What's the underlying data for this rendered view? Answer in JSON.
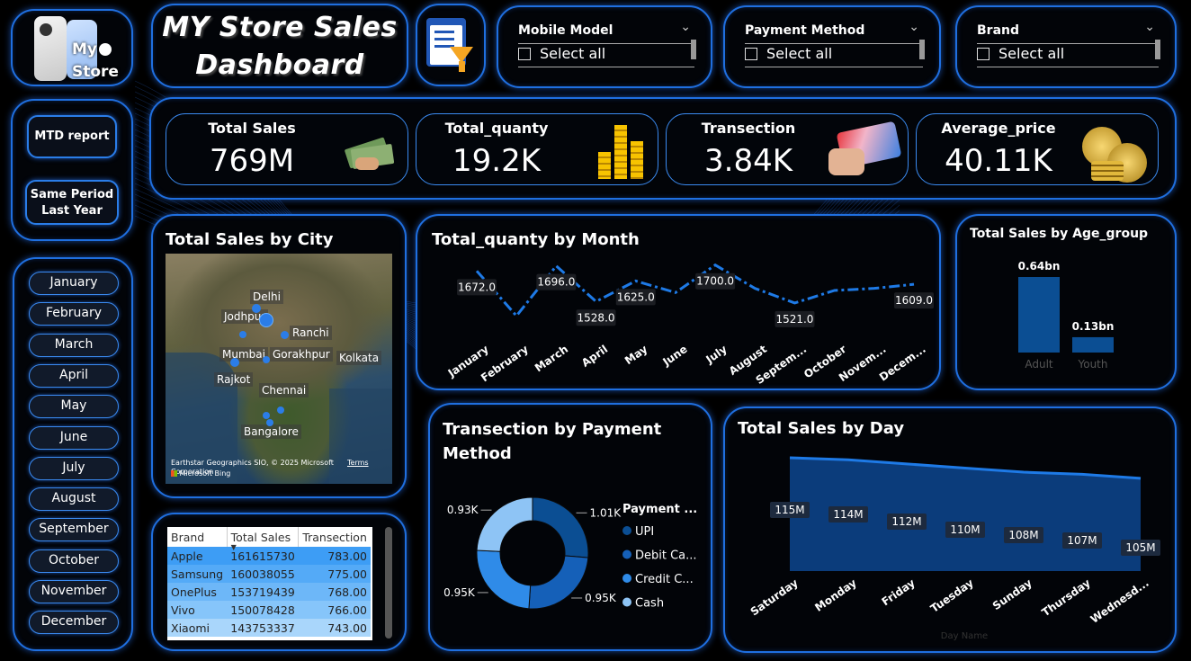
{
  "logo": {
    "line1": "My",
    "line2": "Store"
  },
  "title": {
    "line1": "MY Store Sales",
    "line2": "Dashboard"
  },
  "slicers": [
    {
      "title": "Mobile Model",
      "option": "Select all"
    },
    {
      "title": "Payment Method",
      "option": "Select all"
    },
    {
      "title": "Brand",
      "option": "Select all"
    }
  ],
  "buttons": {
    "mtd": "MTD report",
    "same_period_1": "Same Period",
    "same_period_2": "Last Year"
  },
  "months": [
    "January",
    "February",
    "March",
    "April",
    "May",
    "June",
    "July",
    "August",
    "September",
    "October",
    "November",
    "December"
  ],
  "kpis": [
    {
      "label": "Total Sales",
      "value": "769M"
    },
    {
      "label": "Total_quanty",
      "value": "19.2K"
    },
    {
      "label": "Transection",
      "value": "3.84K"
    },
    {
      "label": "Average_price",
      "value": "40.11K"
    }
  ],
  "map": {
    "title": "Total Sales by City",
    "cities": [
      "Delhi",
      "Jodhpur",
      "Ranchi",
      "Mumbai",
      "Gorakhpur",
      "Kolkata",
      "Rajkot",
      "Chennai",
      "Bangalore"
    ],
    "attribution": "Earthstar Geographics SIO, © 2025 Microsoft Corporation",
    "terms": "Terms",
    "bing": "Microsoft Bing"
  },
  "table": {
    "headers": [
      "Brand",
      "Total Sales",
      "Transection"
    ],
    "rows": [
      [
        "Apple",
        "161615730",
        "783.00"
      ],
      [
        "Samsung",
        "160038055",
        "775.00"
      ],
      [
        "OnePlus",
        "153719439",
        "768.00"
      ],
      [
        "Vivo",
        "150078428",
        "766.00"
      ],
      [
        "Xiaomi",
        "143753337",
        "743.00"
      ]
    ]
  },
  "colors": {
    "accent": "#1f6fe0",
    "bar": "#0b4e93",
    "line": "#1e7ae6"
  },
  "chart_data": [
    {
      "type": "line",
      "title": "Total_quanty by Month",
      "categories": [
        "January",
        "February",
        "March",
        "April",
        "May",
        "June",
        "July",
        "August",
        "Septem...",
        "October",
        "Novem...",
        "Decem..."
      ],
      "values": [
        1672.0,
        1460,
        1696.0,
        1528.0,
        1625.0,
        1570,
        1700.0,
        1590,
        1521.0,
        1580,
        1590,
        1609.0
      ],
      "data_labels": [
        {
          "index": 0,
          "text": "1672.0"
        },
        {
          "index": 2,
          "text": "1696.0"
        },
        {
          "index": 3,
          "text": "1528.0"
        },
        {
          "index": 4,
          "text": "1625.0"
        },
        {
          "index": 6,
          "text": "1700.0"
        },
        {
          "index": 8,
          "text": "1521.0"
        },
        {
          "index": 11,
          "text": "1609.0"
        }
      ]
    },
    {
      "type": "bar",
      "title": "Total Sales by Age_group",
      "categories": [
        "Adult",
        "Youth"
      ],
      "values": [
        0.64,
        0.13
      ],
      "value_labels": [
        "0.64bn",
        "0.13bn"
      ]
    },
    {
      "type": "pie",
      "title": "Transection by Payment Method",
      "legend_title": "Payment ...",
      "series": [
        {
          "name": "UPI",
          "value": 1.01,
          "label": "1.01K",
          "color": "#0b4e93"
        },
        {
          "name": "Debit Ca...",
          "value": 0.95,
          "label": "0.95K",
          "color": "#1560b8"
        },
        {
          "name": "Credit C...",
          "value": 0.95,
          "label": "0.95K",
          "color": "#2f8be8"
        },
        {
          "name": "Cash",
          "value": 0.93,
          "label": "0.93K",
          "color": "#8ec4f5"
        }
      ]
    },
    {
      "type": "area",
      "title": "Total Sales by Day",
      "xlabel": "Day Name",
      "categories": [
        "Saturday",
        "Monday",
        "Friday",
        "Tuesday",
        "Sunday",
        "Thursday",
        "Wednesd..."
      ],
      "values": [
        115,
        114,
        112,
        110,
        108,
        107,
        105
      ],
      "value_labels": [
        "115M",
        "114M",
        "112M",
        "110M",
        "108M",
        "107M",
        "105M"
      ]
    }
  ]
}
